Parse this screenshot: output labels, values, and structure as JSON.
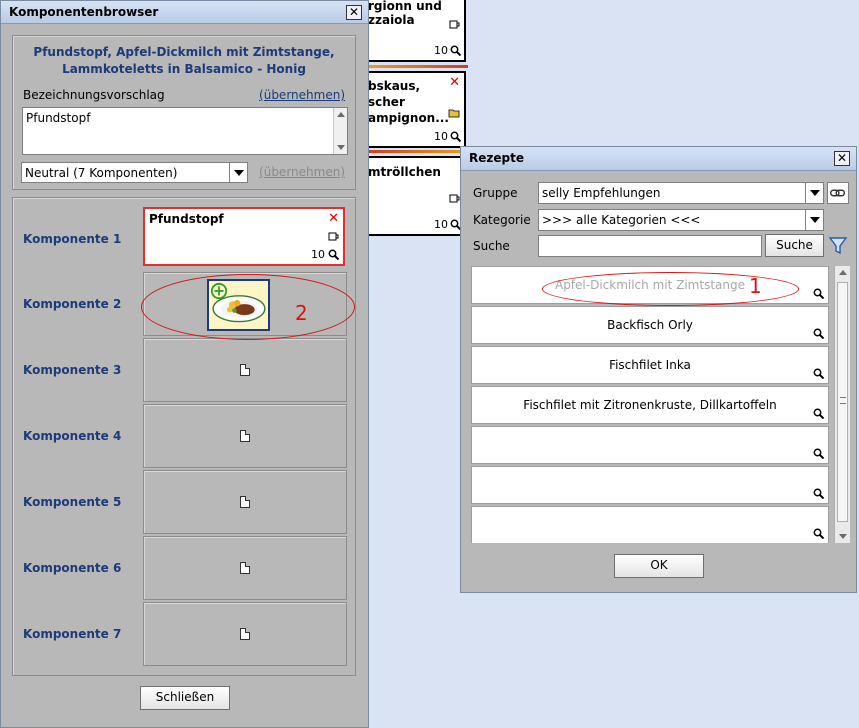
{
  "background_cards": [
    {
      "title": "rgionn und",
      "title2": "zzaiola",
      "count": "10"
    },
    {
      "title": "bskaus,",
      "title2": "scher",
      "title3": "ampignon...",
      "count": "10"
    },
    {
      "title": "mtröllchen",
      "count": "10"
    }
  ],
  "komponentenbrowser": {
    "title": "Komponentenbrowser",
    "heading_line1": "Pfundstopf, Apfel-Dickmilch mit Zimtstange,",
    "heading_line2": "Lammkoteletts in Balsamico - Honig",
    "suggestion_label": "Bezeichnungsvorschlag",
    "apply_link": "(übernehmen)",
    "suggestion_value": "Pfundstopf",
    "category_value": "Neutral (7 Komponenten)",
    "apply_link_disabled": "(übernehmen)",
    "components": [
      {
        "label": "Komponente 1",
        "card_title": "Pfundstopf",
        "count": "10"
      },
      {
        "label": "Komponente 2"
      },
      {
        "label": "Komponente 3"
      },
      {
        "label": "Komponente 4"
      },
      {
        "label": "Komponente 5"
      },
      {
        "label": "Komponente 6"
      },
      {
        "label": "Komponente 7"
      }
    ],
    "close_button": "Schließen"
  },
  "rezepte": {
    "title": "Rezepte",
    "gruppe_label": "Gruppe",
    "gruppe_value": "selly Empfehlungen",
    "kategorie_label": "Kategorie",
    "kategorie_value": ">>> alle Kategorien <<<",
    "suche_label": "Suche",
    "suche_value": "",
    "suche_button": "Suche",
    "items": [
      "Apfel-Dickmilch mit Zimtstange",
      "Backfisch Orly",
      "Fischfilet Inka",
      "Fischfilet mit Zitronenkruste, Dillkartoffeln",
      "",
      "",
      ""
    ],
    "ok_button": "OK"
  },
  "annotations": {
    "one": "1",
    "two": "2"
  },
  "colors": {
    "accent_red": "#d01818",
    "heading_blue": "#1b3b7a",
    "window_gray": "#b8b8b8"
  }
}
